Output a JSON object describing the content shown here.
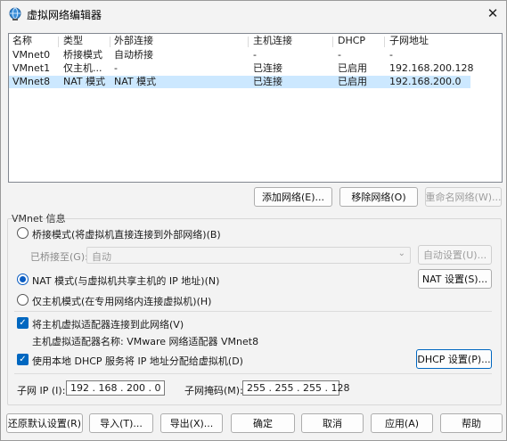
{
  "window": {
    "title": "虚拟网络编辑器"
  },
  "list": {
    "headers": [
      "名称",
      "类型",
      "外部连接",
      "主机连接",
      "DHCP",
      "子网地址"
    ],
    "rows": [
      [
        "VMnet0",
        "桥接模式",
        "自动桥接",
        "-",
        "-",
        "-"
      ],
      [
        "VMnet1",
        "仅主机...",
        "-",
        "已连接",
        "已启用",
        "192.168.200.128"
      ],
      [
        "VMnet8",
        "NAT 模式",
        "NAT 模式",
        "已连接",
        "已启用",
        "192.168.200.0"
      ]
    ],
    "selected_row": 2
  },
  "list_buttons": {
    "add": "添加网络(E)...",
    "remove": "移除网络(O)",
    "rename": "重命名网络(W)..."
  },
  "vmnet_info": {
    "group_label": "VMnet 信息",
    "bridged_radio": "桥接模式(将虚拟机直接连接到外部网络)(B)",
    "bridged_to_label": "已桥接至(G):",
    "bridged_to_value": "自动",
    "auto_settings_button": "自动设置(U)...",
    "nat_radio": "NAT 模式(与虚拟机共享主机的 IP 地址)(N)",
    "nat_settings_button": "NAT 设置(S)...",
    "hostonly_radio": "仅主机模式(在专用网络内连接虚拟机)(H)",
    "selected_mode": "nat",
    "connect_adapter_check": "将主机虚拟适配器连接到此网络(V)",
    "adapter_name": "主机虚拟适配器名称: VMware 网络适配器 VMnet8",
    "dhcp_check": "使用本地 DHCP 服务将 IP 地址分配给虚拟机(D)",
    "dhcp_settings_button": "DHCP 设置(P)...",
    "subnet_ip_label": "子网 IP (I):",
    "subnet_ip": "192 . 168 . 200 .  0",
    "subnet_mask_label": "子网掩码(M):",
    "subnet_mask": "255 . 255 . 255 . 128"
  },
  "footer": {
    "restore": "还原默认设置(R)",
    "import": "导入(T)...",
    "export": "导出(X)...",
    "ok": "确定",
    "cancel": "取消",
    "apply": "应用(A)",
    "help": "帮助"
  },
  "colors": {
    "accent": "#0067c0",
    "selection": "#cce8ff"
  }
}
